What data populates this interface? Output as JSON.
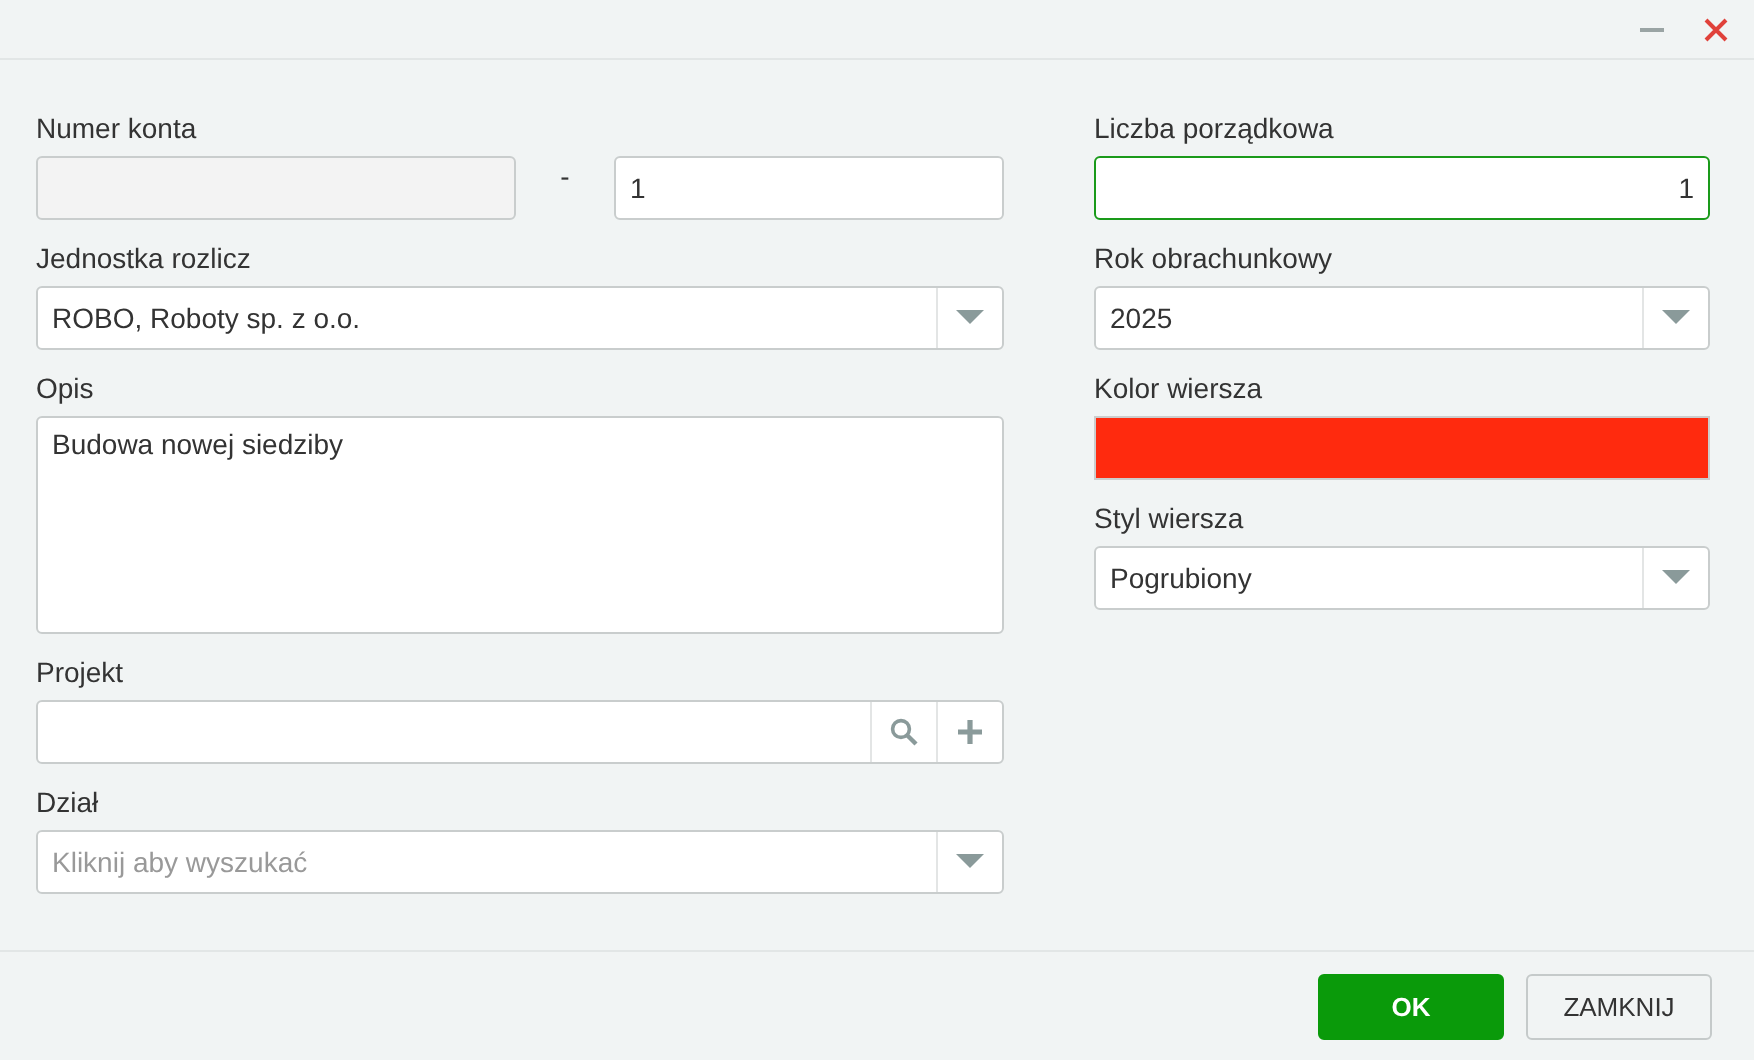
{
  "left": [
    {
      "label": "Numer konta",
      "kind": "account",
      "prefix_disabled": true,
      "separator": "-",
      "value": "1"
    },
    {
      "label": "Jednostka rozlicz",
      "kind": "select",
      "value": "ROBO, Roboty sp. z o.o."
    },
    {
      "label": "Opis",
      "kind": "textarea",
      "value": "Budowa nowej siedziby"
    },
    {
      "label": "Projekt",
      "kind": "lookup"
    },
    {
      "label": "Dział",
      "kind": "select",
      "placeholder": "Kliknij aby wyszukać"
    }
  ],
  "right": [
    {
      "label": "Liczba porządkowa",
      "kind": "text",
      "value": "1",
      "focused": true
    },
    {
      "label": "Rok obrachunkowy",
      "kind": "select",
      "value": "2025"
    },
    {
      "label": "Kolor wiersza",
      "kind": "color",
      "color": "#ff2a0e"
    },
    {
      "label": "Styl wiersza",
      "kind": "select",
      "value": "Pogrubiony"
    }
  ],
  "buttons": [
    {
      "label": "OK",
      "kind": "primary"
    },
    {
      "label": "ZAMKNIJ",
      "kind": "secondary"
    }
  ]
}
